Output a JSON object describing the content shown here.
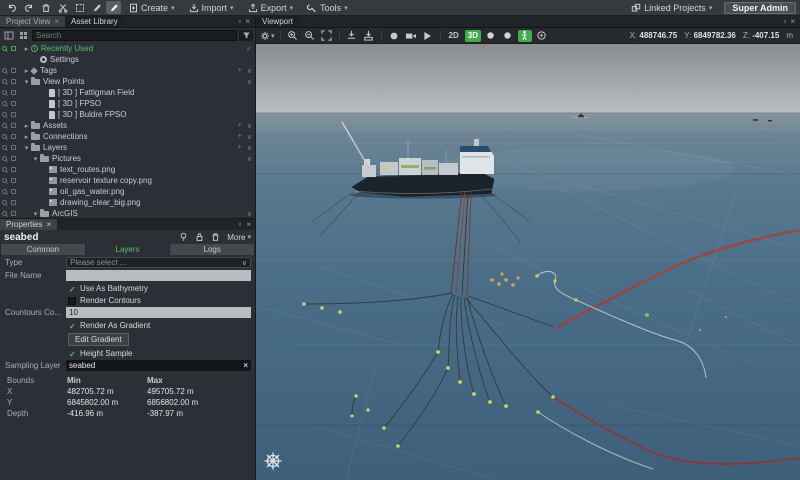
{
  "menubar": {
    "menus": [
      {
        "label": "Create"
      },
      {
        "label": "Import"
      },
      {
        "label": "Export"
      },
      {
        "label": "Tools"
      }
    ],
    "linked_projects": "Linked Projects",
    "user": "Super Admin",
    "icons": [
      "undo-icon",
      "redo-icon",
      "trash-icon",
      "cut-icon",
      "select-icon",
      "draw-icon",
      "draw-active-icon",
      "linked-projects-icon"
    ]
  },
  "tabs": {
    "project_view": "Project View",
    "asset_library": "Asset Library",
    "viewport": "Viewport"
  },
  "sidebar": {
    "search_placeholder": "Search",
    "icons": [
      "panel-toggle-icon",
      "grid-icon",
      "filter-icon"
    ],
    "tree": [
      {
        "label": "Recently Used",
        "lvl": 0,
        "arrow": "right",
        "icon": "recent",
        "green": true,
        "right": [
          "check"
        ]
      },
      {
        "label": "Settings",
        "lvl": 1,
        "arrow": null,
        "icon": "gear",
        "nogut": true,
        "right": []
      },
      {
        "label": "Tags",
        "lvl": 0,
        "arrow": "right",
        "icon": "tag",
        "right": [
          "plus",
          "caret"
        ]
      },
      {
        "label": "View Points",
        "lvl": 0,
        "arrow": "down",
        "icon": "folder",
        "right": [
          "caret"
        ]
      },
      {
        "label": "[ 3D ] Fattigman Field",
        "lvl": 2,
        "arrow": null,
        "icon": "page",
        "right": []
      },
      {
        "label": "[ 3D ] FPSO",
        "lvl": 2,
        "arrow": null,
        "icon": "page",
        "right": []
      },
      {
        "label": "[ 3D ] Buldre FPSO",
        "lvl": 2,
        "arrow": null,
        "icon": "page",
        "right": []
      },
      {
        "label": "Assets",
        "lvl": 0,
        "arrow": "right",
        "icon": "folder",
        "right": [
          "plus",
          "caret"
        ]
      },
      {
        "label": "Connections",
        "lvl": 0,
        "arrow": "right",
        "icon": "folder",
        "right": [
          "plus",
          "caret"
        ]
      },
      {
        "label": "Layers",
        "lvl": 0,
        "arrow": "down",
        "icon": "folder",
        "right": [
          "plus",
          "caret"
        ]
      },
      {
        "label": "Pictures",
        "lvl": 1,
        "arrow": "down",
        "icon": "folder",
        "right": [
          "caret"
        ]
      },
      {
        "label": "text_routes.png",
        "lvl": 2,
        "arrow": null,
        "icon": "image",
        "right": []
      },
      {
        "label": "reservoir texture copy.png",
        "lvl": 2,
        "arrow": null,
        "icon": "image",
        "right": []
      },
      {
        "label": "oil_gas_water.png",
        "lvl": 2,
        "arrow": null,
        "icon": "image",
        "right": []
      },
      {
        "label": "drawing_clear_big.png",
        "lvl": 2,
        "arrow": null,
        "icon": "image",
        "right": []
      },
      {
        "label": "ArcGIS",
        "lvl": 1,
        "arrow": "down",
        "icon": "folder",
        "right": [
          "caret"
        ]
      }
    ]
  },
  "properties": {
    "tab_label": "Properties",
    "title": "seabed",
    "more_label": "More",
    "header_icons": [
      "bulb-icon",
      "lock-icon",
      "trash-icon"
    ],
    "tabs": [
      "Common",
      "Layers",
      "Logs"
    ],
    "active_tab": "Layers",
    "fields": {
      "type_label": "Type",
      "type_value": "Please select ...",
      "file_label": "File Name",
      "file_value": "",
      "contours_label": "Countours Co...",
      "contours_value": "10",
      "sampling_label": "Sampling Layer",
      "sampling_value": "seabed"
    },
    "checkboxes": [
      {
        "label": "Use As Bathymetry",
        "checked": true
      },
      {
        "label": "Render Contours",
        "checked": false
      },
      {
        "label": "Render As Gradient",
        "checked": true
      },
      {
        "label": "Height Sample",
        "checked": true
      }
    ],
    "edit_gradient_label": "Edit Gradient",
    "bounds": {
      "header": [
        "Bounds",
        "Min",
        "Max"
      ],
      "rows": [
        [
          "X",
          "482705.72 m",
          "495705.72 m"
        ],
        [
          "Y",
          "6845802.00 m",
          "6856802.00 m"
        ],
        [
          "Depth",
          "-416.96 m",
          "-387.97 m"
        ]
      ]
    }
  },
  "viewport": {
    "toolbar": {
      "mode_2d": "2D",
      "mode_3d": "3D",
      "icons": [
        "gear-icon",
        "zoom-in-icon",
        "zoom-out-icon",
        "fullscreen-icon",
        "save-view-icon",
        "load-view-icon",
        "record-icon",
        "video-camera-icon",
        "play-icon",
        "toggle-circle-icon",
        "toggle-circle-icon",
        "walk-mode-icon",
        "target-icon"
      ]
    },
    "coords": {
      "x_label": "X:",
      "x_value": "488746.75",
      "y_label": "Y:",
      "y_value": "6849782.36",
      "z_label": "Z:",
      "z_value": "-407.15",
      "unit": "m"
    },
    "scene_icons": [
      "helm-icon"
    ]
  },
  "colors": {
    "accent_green": "#3fae4a",
    "selection_green": "#4caf50",
    "pipeline_red": "#9b3027",
    "marker_yellow": "#cdd455",
    "sky_gray": "#aeb1b3",
    "sea_blue": "#4b6e88"
  }
}
